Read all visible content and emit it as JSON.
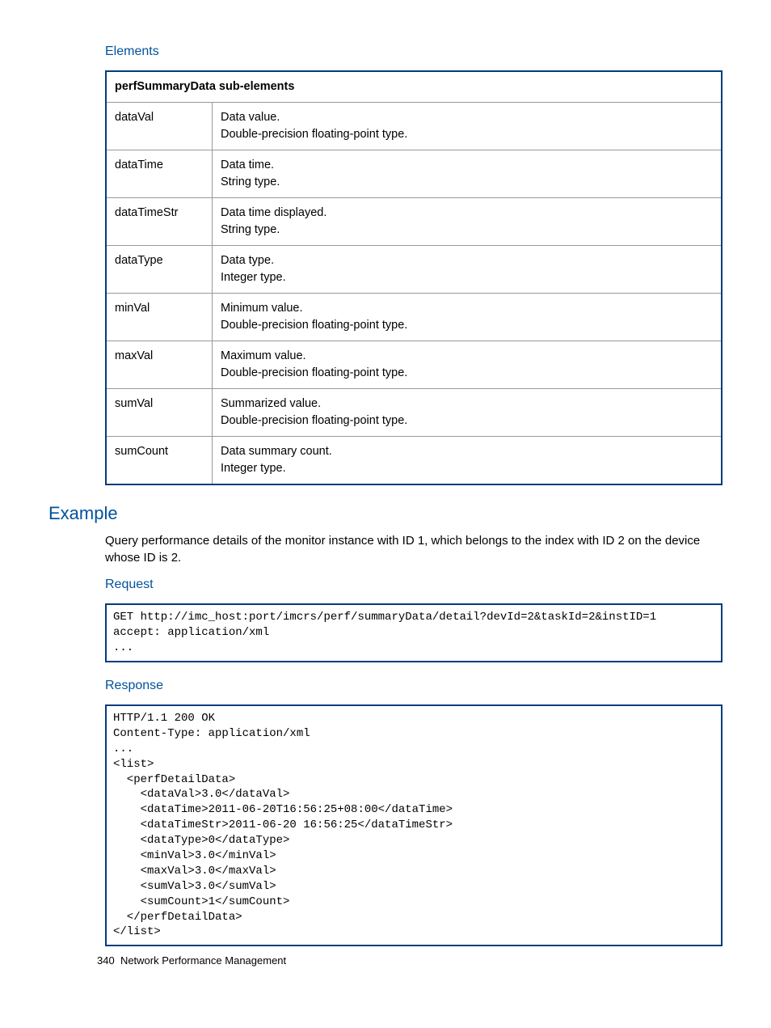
{
  "headings": {
    "elements": "Elements",
    "example": "Example",
    "request": "Request",
    "response": "Response"
  },
  "table": {
    "header": "perfSummaryData sub-elements",
    "rows": [
      {
        "name": "dataVal",
        "desc": "Data value.\nDouble-precision floating-point type."
      },
      {
        "name": "dataTime",
        "desc": "Data time.\nString type."
      },
      {
        "name": "dataTimeStr",
        "desc": "Data time displayed.\nString type."
      },
      {
        "name": "dataType",
        "desc": "Data type.\nInteger type."
      },
      {
        "name": "minVal",
        "desc": "Minimum value.\nDouble-precision floating-point type."
      },
      {
        "name": "maxVal",
        "desc": "Maximum value.\nDouble-precision floating-point type."
      },
      {
        "name": "sumVal",
        "desc": "Summarized value.\nDouble-precision floating-point type."
      },
      {
        "name": "sumCount",
        "desc": "Data summary count.\nInteger type."
      }
    ]
  },
  "example_text": "Query performance details of the monitor instance with ID 1, which belongs to the index with ID 2 on the device whose ID is 2.",
  "request_code": "GET http://imc_host:port/imcrs/perf/summaryData/detail?devId=2&taskId=2&instID=1\naccept: application/xml\n...",
  "response_code": "HTTP/1.1 200 OK\nContent-Type: application/xml\n...\n<list>\n  <perfDetailData>\n    <dataVal>3.0</dataVal>\n    <dataTime>2011-06-20T16:56:25+08:00</dataTime>\n    <dataTimeStr>2011-06-20 16:56:25</dataTimeStr>\n    <dataType>0</dataType>\n    <minVal>3.0</minVal>\n    <maxVal>3.0</maxVal>\n    <sumVal>3.0</sumVal>\n    <sumCount>1</sumCount>\n  </perfDetailData>\n</list>",
  "footer": {
    "page": "340",
    "section": "Network Performance Management"
  }
}
